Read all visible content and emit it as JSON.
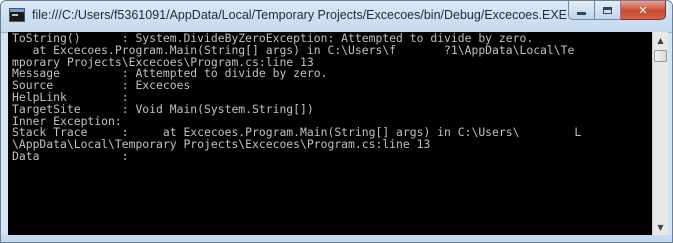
{
  "window": {
    "title": "file:///C:/Users/f5361091/AppData/Local/Temporary Projects/Excecoes/bin/Debug/Excecoes.EXE",
    "minimize_icon": "minimize-icon",
    "maximize_icon": "maximize-icon",
    "close_glyph": "✕"
  },
  "console": {
    "lines": [
      "ToString()      : System.DivideByZeroException: Attempted to divide by zero.",
      "   at Excecoes.Program.Main(String[] args) in C:\\Users\\f       ?1\\AppData\\Local\\Te",
      "mporary Projects\\Excecoes\\Program.cs:line 13",
      "Message         : Attempted to divide by zero.",
      "Source          : Excecoes",
      "HelpLink        :",
      "TargetSite      : Void Main(System.String[])",
      "Inner Exception:",
      "Stack Trace     :     at Excecoes.Program.Main(String[] args) in C:\\Users\\        L",
      "\\AppData\\Local\\Temporary Projects\\Excecoes\\Program.cs:line 13",
      "Data            :"
    ]
  },
  "scrollbar": {
    "up_arrow": "▲",
    "down_arrow": "▼"
  }
}
